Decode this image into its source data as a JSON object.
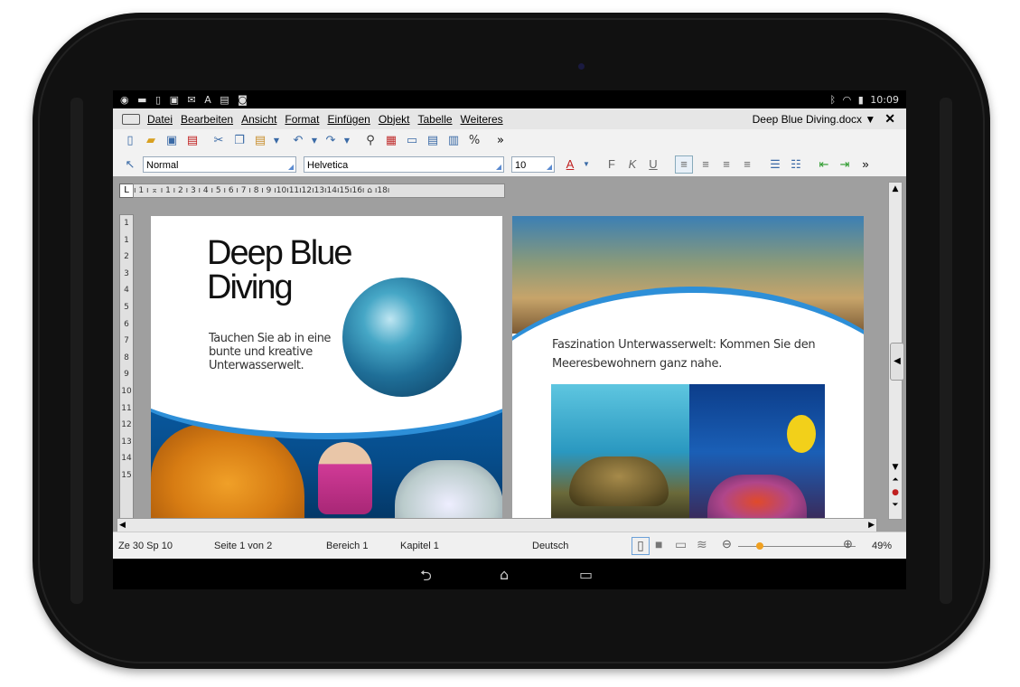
{
  "status_bar": {
    "time": "10:09",
    "left_icons": [
      "chat-icon",
      "notification-icon",
      "phone-icon",
      "image-icon",
      "mail-icon",
      "app-icon",
      "briefcase-icon",
      "camera-icon"
    ],
    "right_icons": [
      "bluetooth-icon",
      "wifi-icon",
      "battery-icon"
    ]
  },
  "menubar": {
    "items": [
      "Datei",
      "Bearbeiten",
      "Ansicht",
      "Format",
      "Einfügen",
      "Objekt",
      "Tabelle",
      "Weiteres"
    ],
    "document_title": "Deep Blue Diving.docx ▼",
    "close": "✕"
  },
  "toolbar": {
    "more": "»"
  },
  "format_bar": {
    "paragraph_style": "Normal",
    "font": "Helvetica",
    "font_size": "10",
    "bold": "F",
    "italic": "K",
    "underline": "U",
    "more": "»"
  },
  "ruler": {
    "corner": "L",
    "horizontal": "ı 1 ı ⌅ ı 1 ı 2 ı 3 ı 4 ı 5 ı 6 ı 7 ı 8 ı 9 ı10ı11ı12ı13ı14ı15ı16ı ⌂ ı18ı",
    "vertical": [
      "1",
      "1",
      "2",
      "3",
      "4",
      "5",
      "6",
      "7",
      "8",
      "9",
      "10",
      "11",
      "12",
      "13",
      "14",
      "15"
    ]
  },
  "page1": {
    "title_line1": "Deep Blue",
    "title_line2": "Diving",
    "subtitle": "Tauchen Sie ab in eine bunte und kreative Unterwasserwelt."
  },
  "page2": {
    "text": "Faszination Unterwasserwelt: Kommen Sie den Meeresbewohnern ganz nahe."
  },
  "status_line": {
    "position": "Ze 30 Sp 10",
    "page": "Seite 1 von 2",
    "section": "Bereich 1",
    "chapter": "Kapitel 1",
    "language": "Deutsch",
    "zoom": "49%"
  },
  "nav": {
    "back": "⮌",
    "home": "⌂",
    "recent": "▭"
  }
}
